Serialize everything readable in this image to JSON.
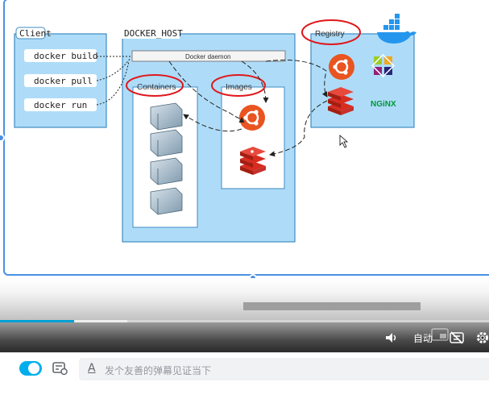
{
  "slide": {
    "client_title": "Client",
    "host_title": "DOCKER_HOST",
    "registry_title": "Registry",
    "daemon_label": "Docker daemon",
    "containers_label": "Containers",
    "images_label": "Images",
    "nginx_label": "NGiNX",
    "commands": [
      "docker build",
      "docker pull",
      "docker run"
    ]
  },
  "player": {
    "quality_label": "自动",
    "progress": 0.152,
    "buffered": 0.26
  },
  "danmaku": {
    "switch_on": true,
    "placeholder": "发个友善的弹幕见证当下",
    "font_icon_text": "A"
  },
  "icons": {
    "volume": "volume-icon",
    "danmaku_off": "danmaku-off-icon",
    "settings": "gear-icon",
    "pip": "picture-in-picture-icon",
    "docker_logo": "docker-whale-icon",
    "ubuntu": "ubuntu-logo-icon",
    "redis": "redis-logo-icon",
    "centos": "centos-logo-icon",
    "container": "container-icon",
    "cursor": "mouse-cursor-icon"
  },
  "colors": {
    "box_fill": "#aedcf8",
    "box_stroke": "#3f8bc2",
    "highlight": "#e0171b",
    "accent": "#00aeec"
  }
}
